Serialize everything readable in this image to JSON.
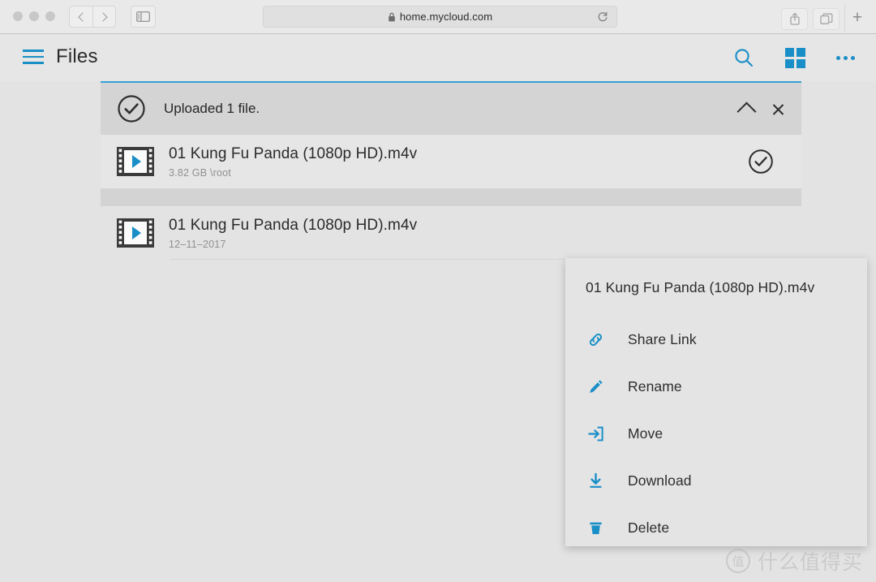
{
  "browser": {
    "url": "home.mycloud.com",
    "lock_icon": "lock-icon",
    "reload_icon": "reload-icon",
    "back_icon": "chevron-left-icon",
    "forward_icon": "chevron-right-icon",
    "sidebar_icon": "sidebar-toggle-icon",
    "share_icon": "share-icon",
    "tabs_icon": "show-tabs-icon",
    "new_tab_label": "+"
  },
  "app_header": {
    "title": "Files",
    "menu_icon": "hamburger-menu-icon",
    "search_icon": "search-icon",
    "grid_icon": "grid-view-icon",
    "more_icon": "more-options-icon",
    "accent_color": "#1a8fc7"
  },
  "notification": {
    "status_icon": "check-circle-icon",
    "message": "Uploaded 1 file.",
    "collapse_icon": "chevron-up-icon",
    "close_icon": "close-icon"
  },
  "upload_row": {
    "file_icon": "video-file-icon",
    "name": "01 Kung Fu Panda (1080p HD).m4v",
    "details": "3.82 GB  \\root",
    "status_icon": "check-circle-icon"
  },
  "file_row": {
    "file_icon": "video-file-icon",
    "name": "01 Kung Fu Panda (1080p HD).m4v",
    "details": "12–11–2017"
  },
  "context_menu": {
    "header": "01 Kung Fu Panda (1080p HD).m4v",
    "items": [
      {
        "label": "Share Link",
        "icon": "link-icon"
      },
      {
        "label": "Rename",
        "icon": "pencil-icon"
      },
      {
        "label": "Move",
        "icon": "move-arrow-icon"
      },
      {
        "label": "Download",
        "icon": "download-icon"
      },
      {
        "label": "Delete",
        "icon": "trash-icon"
      }
    ]
  },
  "watermark": {
    "badge": "值",
    "text": "什么值得买"
  }
}
